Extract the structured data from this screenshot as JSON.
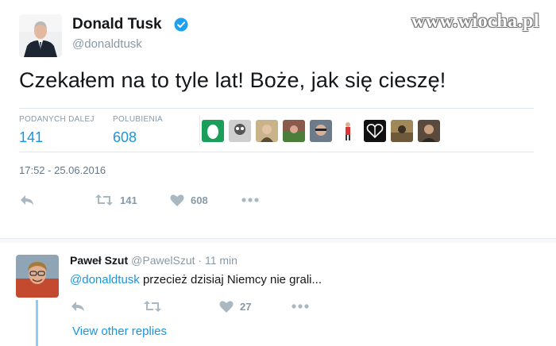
{
  "watermark": "www.wiocha.pl",
  "tweet": {
    "author_name": "Donald Tusk",
    "author_handle": "@donaldtusk",
    "text": "Czekałem na to tyle lat! Boże, jak się cieszę!",
    "stats": {
      "retweets_label": "PODANYCH DALEJ",
      "retweets_value": "141",
      "likes_label": "POLUBIENIA",
      "likes_value": "608"
    },
    "timestamp": "17:52 - 25.06.2016",
    "actions": {
      "retweet_count": "141",
      "like_count": "608"
    }
  },
  "reply": {
    "author_name": "Paweł Szut",
    "author_handle": "@PawelSzut",
    "separator": " · ",
    "time": "11 min",
    "mention": "@donaldtusk",
    "text": " przecież dzisiaj Niemcy nie grali...",
    "like_count": "27",
    "view_other_replies": "View other replies"
  },
  "colors": {
    "accent": "#1b95e0",
    "muted": "#8899a6",
    "thread_line": "#8ecdf8"
  }
}
